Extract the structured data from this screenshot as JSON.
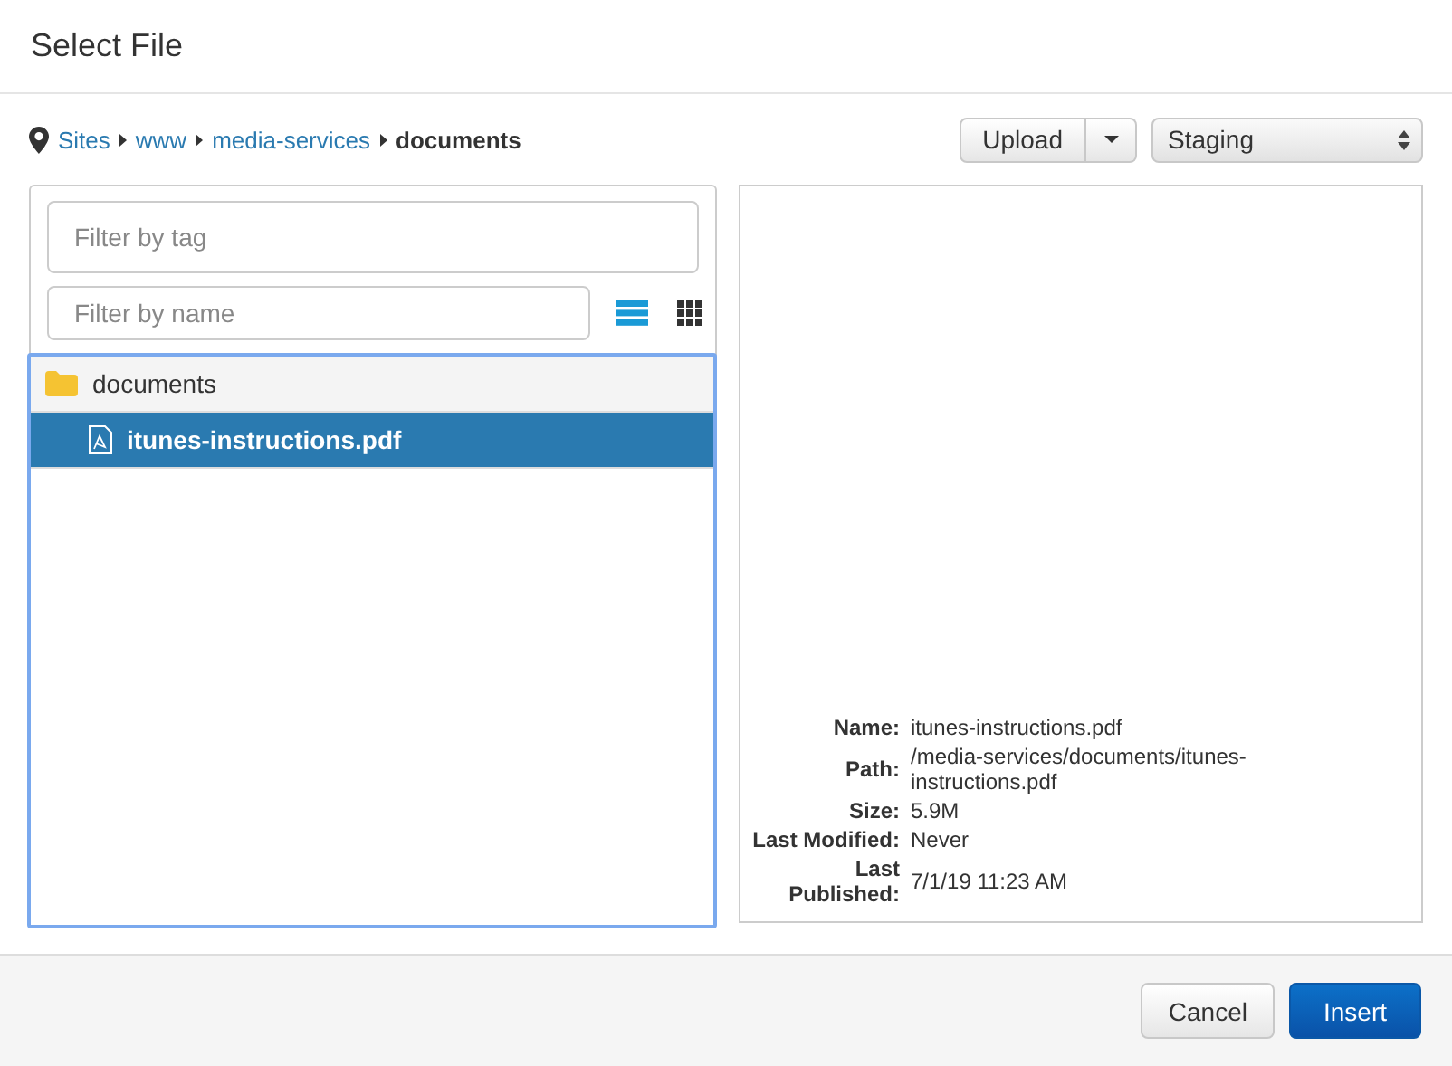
{
  "window": {
    "title": "Select File"
  },
  "breadcrumb": [
    {
      "label": "Sites",
      "kind": "link"
    },
    {
      "label": "www",
      "kind": "link"
    },
    {
      "label": "media-services",
      "kind": "link"
    },
    {
      "label": "documents",
      "kind": "current"
    }
  ],
  "upload_button": {
    "label": "Upload"
  },
  "site_select": {
    "value": "Staging"
  },
  "tag_filter": {
    "placeholder": "Filter by tag"
  },
  "name_filter": {
    "placeholder": "Filter by name"
  },
  "view_toggles": [
    {
      "kind": "list",
      "selected": true
    },
    {
      "kind": "grid",
      "selected": false
    }
  ],
  "tree": [
    {
      "label": "documents",
      "kind": "folder",
      "selected": false,
      "children": [
        {
          "label": "itunes-instructions.pdf",
          "kind": "pdf",
          "selected": true
        }
      ]
    }
  ],
  "details": [
    {
      "label": "Name:",
      "value": "itunes-instructions.pdf"
    },
    {
      "label": "Path:",
      "value": "/media-services/documents/itunes-instructions.pdf"
    },
    {
      "label": "Size:",
      "value": "5.9M"
    },
    {
      "label": "Last Modified:",
      "value": "Never"
    },
    {
      "label": "Last Published:",
      "value": "7/1/19 11:23 AM"
    }
  ],
  "buttons": [
    {
      "label": "Cancel",
      "kind": "secondary"
    },
    {
      "label": "Insert",
      "kind": "primary"
    }
  ]
}
